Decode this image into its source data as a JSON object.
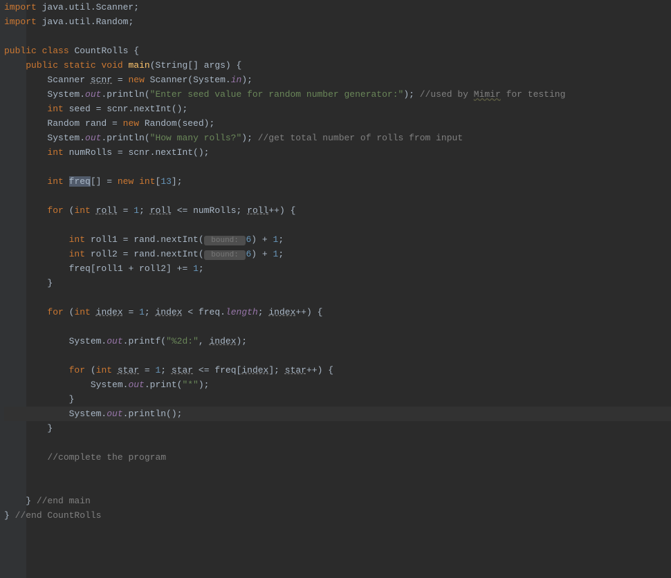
{
  "code": {
    "l1": {
      "kw1": "import",
      "pkg": " java.util.Scanner",
      "semi": ";"
    },
    "l2": {
      "kw1": "import",
      "pkg": " java.util.Random",
      "semi": ";"
    },
    "l4": {
      "kw1": "public",
      "kw2": "class",
      "name": " CountRolls {"
    },
    "l5": {
      "kw1": "public",
      "kw2": "static",
      "kw3": "void",
      "method": "main",
      "params": "(String[] args) {"
    },
    "l6": {
      "type": "Scanner ",
      "var": "scnr",
      "eq": " = ",
      "kw": "new",
      "ctor": " Scanner(System.",
      "field": "in",
      "end": ");"
    },
    "l7": {
      "sys": "System.",
      "out": "out",
      "dot": ".println(",
      "str": "\"Enter seed value for random number generator:\"",
      "end": "); ",
      "comment": "//used by ",
      "mimir": "Mimir",
      "comment2": " for testing"
    },
    "l8": {
      "kw": "int",
      "var": " seed = scnr.nextInt();"
    },
    "l9": {
      "type": "Random rand = ",
      "kw": "new",
      "ctor": " Random(seed);"
    },
    "l10": {
      "sys": "System.",
      "out": "out",
      "dot": ".println(",
      "str": "\"How many rolls?\"",
      "end": "); ",
      "comment": "//get total number of rolls from input"
    },
    "l11": {
      "kw": "int",
      "var": " numRolls = scnr.nextInt();"
    },
    "l13": {
      "kw": "int",
      "sp": " ",
      "freq": "freq",
      "arr": "[] = ",
      "kw2": "new",
      "sp2": " ",
      "kw3": "int",
      "br": "[",
      "num": "13",
      "end": "];"
    },
    "l15": {
      "kw": "for",
      "open": " (",
      "kw2": "int",
      "sp": " ",
      "roll1": "roll",
      "eq": " = ",
      "n1": "1",
      "semi": "; ",
      "roll2": "roll",
      "le": " <= numRolls; ",
      "roll3": "roll",
      "end": "++) {"
    },
    "l17": {
      "kw": "int",
      "var": " roll1 = rand.nextInt(",
      "hint": " bound: ",
      "n6": "6",
      "plus": ") + ",
      "n1": "1",
      "semi": ";"
    },
    "l18": {
      "kw": "int",
      "var": " roll2 = rand.nextInt(",
      "hint": " bound: ",
      "n6": "6",
      "plus": ") + ",
      "n1": "1",
      "semi": ";"
    },
    "l19": {
      "var": "freq[roll1 + roll2] += ",
      "n1": "1",
      "semi": ";"
    },
    "l20": {
      "brace": "}"
    },
    "l22": {
      "kw": "for",
      "open": " (",
      "kw2": "int",
      "sp": " ",
      "idx1": "index",
      "eq": " = ",
      "n1": "1",
      "semi": "; ",
      "idx2": "index",
      "lt": " < freq.",
      "len": "length",
      "semi2": "; ",
      "idx3": "index",
      "end": "++) {"
    },
    "l24": {
      "sys": "System.",
      "out": "out",
      "dot": ".printf(",
      "str": "\"%2d:\"",
      "comma": ", ",
      "idx": "index",
      "end": ");"
    },
    "l26": {
      "kw": "for",
      "open": " (",
      "kw2": "int",
      "sp": " ",
      "star1": "star",
      "eq": " = ",
      "n1": "1",
      "semi": "; ",
      "star2": "star",
      "le": " <= freq[",
      "idx": "index",
      "br": "]; ",
      "star3": "star",
      "end": "++) {"
    },
    "l27": {
      "sys": "System.",
      "out": "out",
      "dot": ".print(",
      "str": "\"*\"",
      "end": ");"
    },
    "l28": {
      "brace": "}"
    },
    "l29": {
      "sys": "System.",
      "out": "out",
      "dot": ".println();"
    },
    "l30": {
      "brace": "}"
    },
    "l32": {
      "comment": "//complete the program"
    },
    "l35": {
      "brace": "} ",
      "comment": "//end main"
    },
    "l36": {
      "brace": "} ",
      "comment": "//end CountRolls"
    }
  }
}
